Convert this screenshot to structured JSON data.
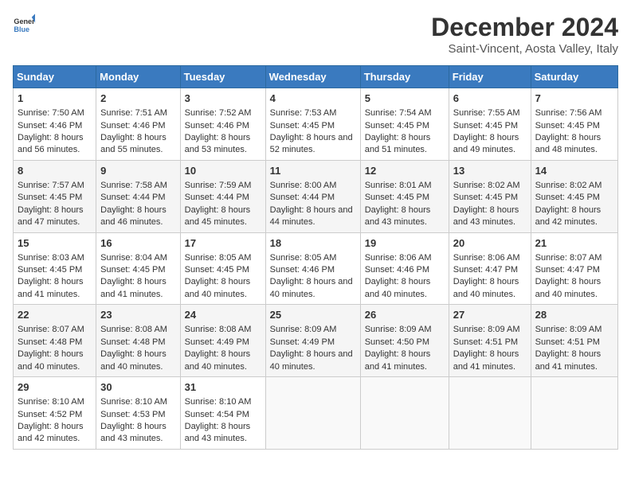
{
  "logo": {
    "general": "General",
    "blue": "Blue"
  },
  "title": "December 2024",
  "subtitle": "Saint-Vincent, Aosta Valley, Italy",
  "headers": [
    "Sunday",
    "Monday",
    "Tuesday",
    "Wednesday",
    "Thursday",
    "Friday",
    "Saturday"
  ],
  "weeks": [
    [
      {
        "day": "1",
        "sunrise": "Sunrise: 7:50 AM",
        "sunset": "Sunset: 4:46 PM",
        "daylight": "Daylight: 8 hours and 56 minutes."
      },
      {
        "day": "2",
        "sunrise": "Sunrise: 7:51 AM",
        "sunset": "Sunset: 4:46 PM",
        "daylight": "Daylight: 8 hours and 55 minutes."
      },
      {
        "day": "3",
        "sunrise": "Sunrise: 7:52 AM",
        "sunset": "Sunset: 4:46 PM",
        "daylight": "Daylight: 8 hours and 53 minutes."
      },
      {
        "day": "4",
        "sunrise": "Sunrise: 7:53 AM",
        "sunset": "Sunset: 4:45 PM",
        "daylight": "Daylight: 8 hours and 52 minutes."
      },
      {
        "day": "5",
        "sunrise": "Sunrise: 7:54 AM",
        "sunset": "Sunset: 4:45 PM",
        "daylight": "Daylight: 8 hours and 51 minutes."
      },
      {
        "day": "6",
        "sunrise": "Sunrise: 7:55 AM",
        "sunset": "Sunset: 4:45 PM",
        "daylight": "Daylight: 8 hours and 49 minutes."
      },
      {
        "day": "7",
        "sunrise": "Sunrise: 7:56 AM",
        "sunset": "Sunset: 4:45 PM",
        "daylight": "Daylight: 8 hours and 48 minutes."
      }
    ],
    [
      {
        "day": "8",
        "sunrise": "Sunrise: 7:57 AM",
        "sunset": "Sunset: 4:45 PM",
        "daylight": "Daylight: 8 hours and 47 minutes."
      },
      {
        "day": "9",
        "sunrise": "Sunrise: 7:58 AM",
        "sunset": "Sunset: 4:44 PM",
        "daylight": "Daylight: 8 hours and 46 minutes."
      },
      {
        "day": "10",
        "sunrise": "Sunrise: 7:59 AM",
        "sunset": "Sunset: 4:44 PM",
        "daylight": "Daylight: 8 hours and 45 minutes."
      },
      {
        "day": "11",
        "sunrise": "Sunrise: 8:00 AM",
        "sunset": "Sunset: 4:44 PM",
        "daylight": "Daylight: 8 hours and 44 minutes."
      },
      {
        "day": "12",
        "sunrise": "Sunrise: 8:01 AM",
        "sunset": "Sunset: 4:45 PM",
        "daylight": "Daylight: 8 hours and 43 minutes."
      },
      {
        "day": "13",
        "sunrise": "Sunrise: 8:02 AM",
        "sunset": "Sunset: 4:45 PM",
        "daylight": "Daylight: 8 hours and 43 minutes."
      },
      {
        "day": "14",
        "sunrise": "Sunrise: 8:02 AM",
        "sunset": "Sunset: 4:45 PM",
        "daylight": "Daylight: 8 hours and 42 minutes."
      }
    ],
    [
      {
        "day": "15",
        "sunrise": "Sunrise: 8:03 AM",
        "sunset": "Sunset: 4:45 PM",
        "daylight": "Daylight: 8 hours and 41 minutes."
      },
      {
        "day": "16",
        "sunrise": "Sunrise: 8:04 AM",
        "sunset": "Sunset: 4:45 PM",
        "daylight": "Daylight: 8 hours and 41 minutes."
      },
      {
        "day": "17",
        "sunrise": "Sunrise: 8:05 AM",
        "sunset": "Sunset: 4:45 PM",
        "daylight": "Daylight: 8 hours and 40 minutes."
      },
      {
        "day": "18",
        "sunrise": "Sunrise: 8:05 AM",
        "sunset": "Sunset: 4:46 PM",
        "daylight": "Daylight: 8 hours and 40 minutes."
      },
      {
        "day": "19",
        "sunrise": "Sunrise: 8:06 AM",
        "sunset": "Sunset: 4:46 PM",
        "daylight": "Daylight: 8 hours and 40 minutes."
      },
      {
        "day": "20",
        "sunrise": "Sunrise: 8:06 AM",
        "sunset": "Sunset: 4:47 PM",
        "daylight": "Daylight: 8 hours and 40 minutes."
      },
      {
        "day": "21",
        "sunrise": "Sunrise: 8:07 AM",
        "sunset": "Sunset: 4:47 PM",
        "daylight": "Daylight: 8 hours and 40 minutes."
      }
    ],
    [
      {
        "day": "22",
        "sunrise": "Sunrise: 8:07 AM",
        "sunset": "Sunset: 4:48 PM",
        "daylight": "Daylight: 8 hours and 40 minutes."
      },
      {
        "day": "23",
        "sunrise": "Sunrise: 8:08 AM",
        "sunset": "Sunset: 4:48 PM",
        "daylight": "Daylight: 8 hours and 40 minutes."
      },
      {
        "day": "24",
        "sunrise": "Sunrise: 8:08 AM",
        "sunset": "Sunset: 4:49 PM",
        "daylight": "Daylight: 8 hours and 40 minutes."
      },
      {
        "day": "25",
        "sunrise": "Sunrise: 8:09 AM",
        "sunset": "Sunset: 4:49 PM",
        "daylight": "Daylight: 8 hours and 40 minutes."
      },
      {
        "day": "26",
        "sunrise": "Sunrise: 8:09 AM",
        "sunset": "Sunset: 4:50 PM",
        "daylight": "Daylight: 8 hours and 41 minutes."
      },
      {
        "day": "27",
        "sunrise": "Sunrise: 8:09 AM",
        "sunset": "Sunset: 4:51 PM",
        "daylight": "Daylight: 8 hours and 41 minutes."
      },
      {
        "day": "28",
        "sunrise": "Sunrise: 8:09 AM",
        "sunset": "Sunset: 4:51 PM",
        "daylight": "Daylight: 8 hours and 41 minutes."
      }
    ],
    [
      {
        "day": "29",
        "sunrise": "Sunrise: 8:10 AM",
        "sunset": "Sunset: 4:52 PM",
        "daylight": "Daylight: 8 hours and 42 minutes."
      },
      {
        "day": "30",
        "sunrise": "Sunrise: 8:10 AM",
        "sunset": "Sunset: 4:53 PM",
        "daylight": "Daylight: 8 hours and 43 minutes."
      },
      {
        "day": "31",
        "sunrise": "Sunrise: 8:10 AM",
        "sunset": "Sunset: 4:54 PM",
        "daylight": "Daylight: 8 hours and 43 minutes."
      },
      null,
      null,
      null,
      null
    ]
  ]
}
